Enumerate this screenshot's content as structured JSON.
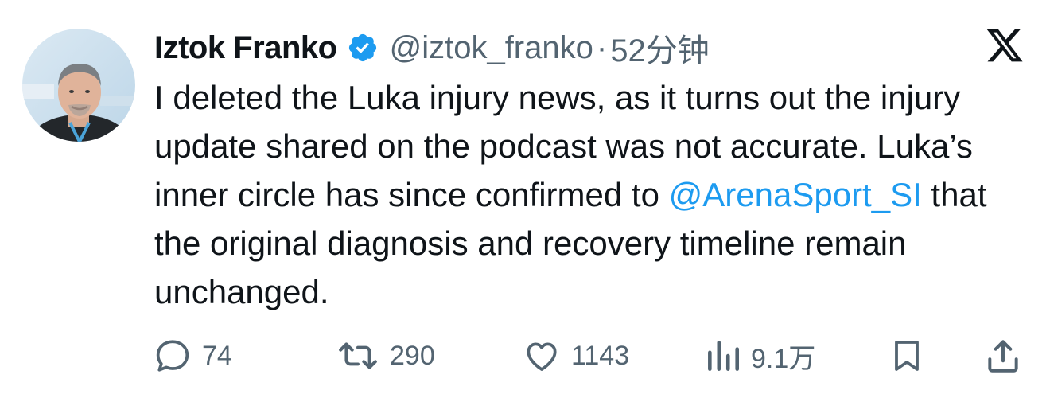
{
  "tweet": {
    "author_name": "Iztok Franko",
    "handle": "@iztok_franko",
    "separator": "·",
    "time": "52分钟",
    "text_before": "I deleted the Luka injury news, as it turns out the injury update shared on the podcast was not accurate. Luka’s inner circle has since confirmed to ",
    "mention": "@ArenaSport_SI",
    "text_after": " that the original diagnosis and recovery timeline remain unchanged."
  },
  "icons": {
    "verified": "verified-badge-icon",
    "platform": "x-logo-icon",
    "reply": "reply-icon",
    "repost": "repost-icon",
    "like": "heart-icon",
    "views": "views-icon",
    "bookmark": "bookmark-icon",
    "share": "share-icon"
  },
  "actions": {
    "replies": "74",
    "reposts": "290",
    "likes": "1143",
    "views": "9.1万"
  },
  "colors": {
    "verified": "#1d9bf0",
    "mention": "#1d9bf0",
    "secondary_text": "#536471",
    "primary_text": "#0f1419"
  }
}
